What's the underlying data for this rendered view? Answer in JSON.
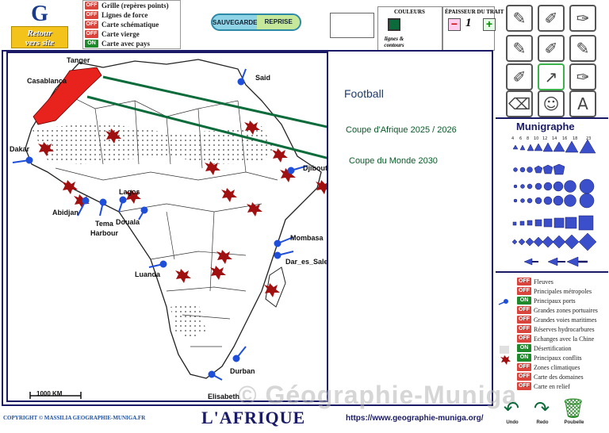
{
  "header": {
    "logo_letters": "G",
    "back_label_1": "Retour",
    "back_label_2": "vers site",
    "options": [
      {
        "state": "OFF",
        "label": "Grille (repères points)"
      },
      {
        "state": "OFF",
        "label": "Lignes de force"
      },
      {
        "state": "OFF",
        "label": "Carte schématique"
      },
      {
        "state": "OFF",
        "label": "Carte vierge"
      },
      {
        "state": "ON",
        "label": "Carte avec pays"
      }
    ],
    "save_label": "SAUVEGARDE",
    "restore_label": "REPRISE",
    "colors_title": "COULEURS",
    "colors_sub": "lignes & contours",
    "color_value": "#0b6b3a",
    "thickness_title": "ÉPAISSEUR DU TRAIT",
    "thickness_value": "1",
    "minus": "−",
    "plus": "+"
  },
  "map": {
    "title": "Football",
    "annotation_1": "Coupe d'Afrique 2025 / 2026",
    "annotation_2": "Coupe du Monde 2030",
    "scale_label": "1000 KM",
    "cities": [
      "Tanger",
      "Casablanca",
      "Dakar",
      "Abidjan",
      "Tema",
      "Harbour",
      "Lagos",
      "Douala",
      "Luanda",
      "Mombasa",
      "Dar_es_Salem",
      "Djibouti",
      "Said",
      "Durban",
      "Elisabeth"
    ]
  },
  "munigraphe": {
    "title": "Munigraphe",
    "sizes": [
      "4",
      "6",
      "8",
      "10",
      "12",
      "14",
      "16",
      "18",
      "23"
    ]
  },
  "legend": [
    {
      "state": "OFF",
      "label": "Fleuves"
    },
    {
      "state": "OFF",
      "label": "Principales métropoles"
    },
    {
      "state": "ON",
      "label": "Principaux ports"
    },
    {
      "state": "OFF",
      "label": "Grandes zones portuaires"
    },
    {
      "state": "OFF",
      "label": "Grandes voies maritimes"
    },
    {
      "state": "OFF",
      "label": "Réserves hydrocarbures"
    },
    {
      "state": "OFF",
      "label": "Echanges avec la Chine"
    },
    {
      "state": "ON",
      "label": "Désertification"
    },
    {
      "state": "ON",
      "label": "Principaux conflits"
    },
    {
      "state": "OFF",
      "label": "Zones climatiques"
    },
    {
      "state": "OFF",
      "label": "Carte des domaines"
    },
    {
      "state": "OFF",
      "label": "Carte en relief"
    }
  ],
  "footer": {
    "copyright": "COPYRIGHT © MASSILIA GEOGRAPHIE-MUNIGA.FR",
    "title": "L'AFRIQUE",
    "url": "https://www.geographie-muniga.org/",
    "watermark": "© Géographie-Muniga",
    "undo": "Undo",
    "redo": "Redo",
    "trash": "Poubelle"
  },
  "colors": {
    "accent": "#1a1a66",
    "green": "#0b6b3a",
    "off": "#d9453d",
    "on": "#1f8a2c",
    "morocco": "#e8231d",
    "port": "#1f4fd8",
    "conflict": "#a01010"
  }
}
